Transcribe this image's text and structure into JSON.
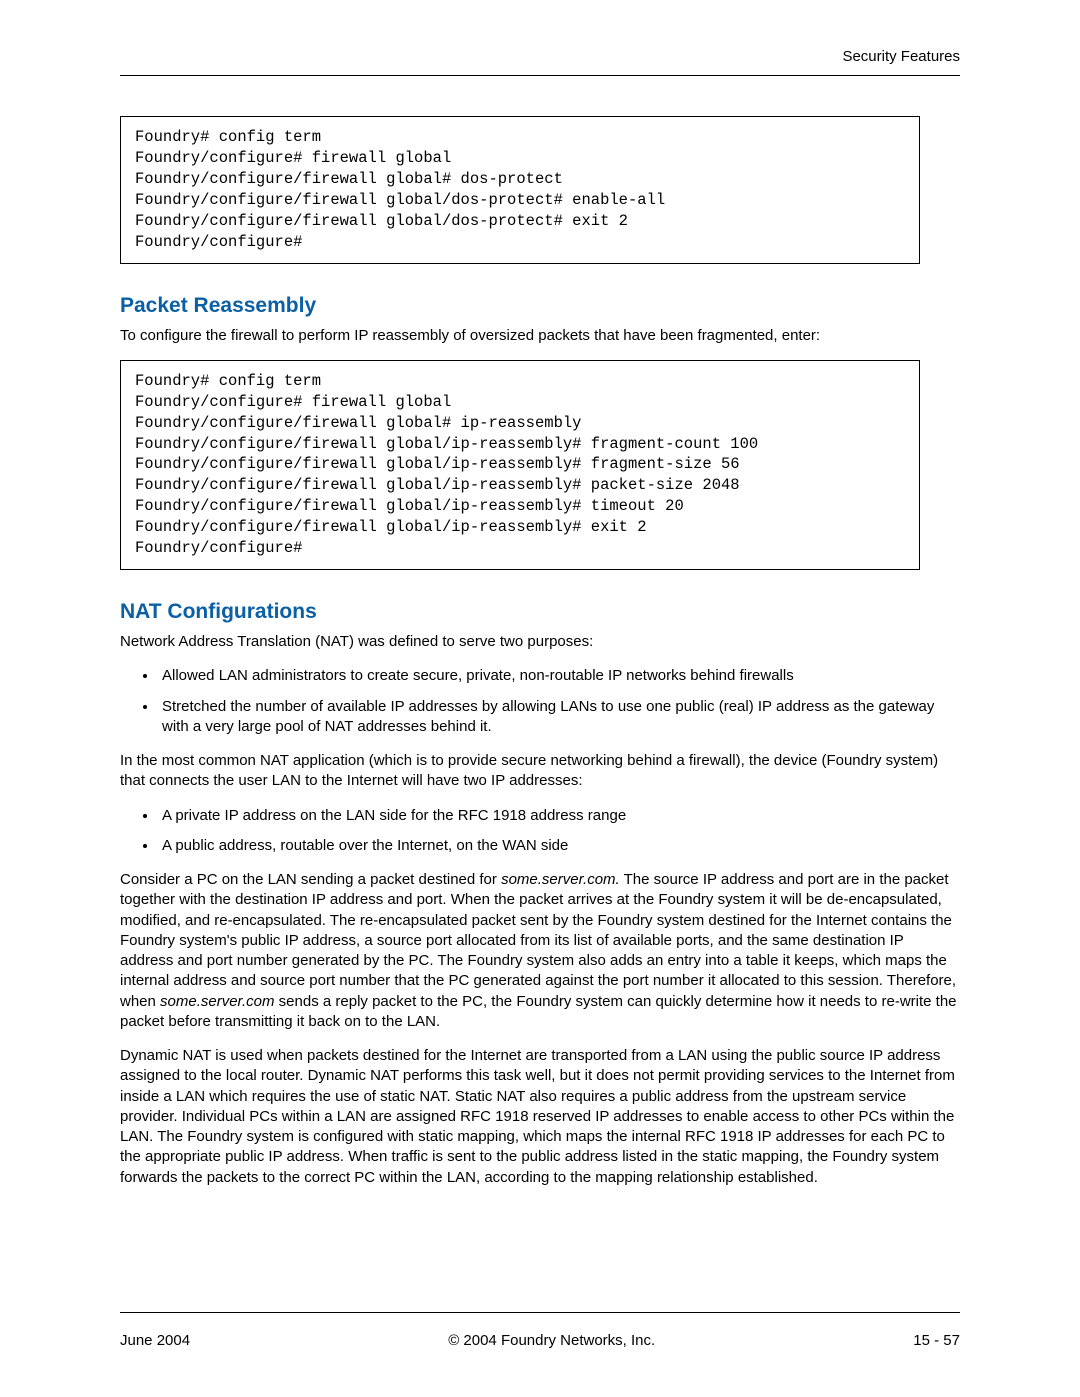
{
  "header": {
    "right_text": "Security Features"
  },
  "code_block_1": "Foundry# config term\nFoundry/configure# firewall global\nFoundry/configure/firewall global# dos-protect\nFoundry/configure/firewall global/dos-protect# enable-all\nFoundry/configure/firewall global/dos-protect# exit 2\nFoundry/configure#",
  "section_1": {
    "title": "Packet Reassembly",
    "para": "To configure the firewall to perform IP reassembly of oversized packets that have been fragmented, enter:"
  },
  "code_block_2": "Foundry# config term\nFoundry/configure# firewall global\nFoundry/configure/firewall global# ip-reassembly\nFoundry/configure/firewall global/ip-reassembly# fragment-count 100\nFoundry/configure/firewall global/ip-reassembly# fragment-size 56\nFoundry/configure/firewall global/ip-reassembly# packet-size 2048\nFoundry/configure/firewall global/ip-reassembly# timeout 20\nFoundry/configure/firewall global/ip-reassembly# exit 2\nFoundry/configure#",
  "section_2": {
    "title": "NAT Configurations",
    "intro": "Network Address Translation (NAT) was defined to serve two purposes:",
    "bullets_a": [
      "Allowed LAN administrators to create secure, private, non-routable IP networks behind firewalls",
      "Stretched the number of available IP addresses by allowing LANs to use one public (real) IP address as the gateway with a very large pool of NAT addresses behind it."
    ],
    "para_b": "In the most common NAT application (which is to provide secure networking behind a firewall), the device (Foundry system) that connects the user LAN to the Internet will have two IP addresses:",
    "bullets_b": [
      "A private IP address on the LAN side for the RFC 1918 address range",
      "A public address, routable over the Internet, on the WAN side"
    ],
    "para_c_pre": "Consider a PC on the LAN sending a packet destined for ",
    "para_c_ital1": "some.server.com.",
    "para_c_mid": " The source IP address and port are in the packet together with the destination IP address and port. When the packet arrives at the Foundry system it will be de-encapsulated, modified, and re-encapsulated. The re-encapsulated packet sent by the Foundry system destined for the Internet contains the Foundry system's public IP address, a source port allocated from its list of available ports, and the same destination IP address and port number generated by the PC. The Foundry system also adds an entry into a table it keeps, which maps the internal address and source port number that the PC generated against the port number it allocated to this session. Therefore, when ",
    "para_c_ital2": "some.server.com",
    "para_c_post": " sends a reply packet to the PC, the Foundry system can quickly determine how it needs to re-write the packet before transmitting it back on to the LAN.",
    "para_d": "Dynamic NAT is used when packets destined for the Internet are transported from a LAN using the public source IP address assigned to the local router. Dynamic NAT performs this task well, but it does not permit providing services to the Internet from inside a LAN which requires the use of static NAT. Static NAT also requires a public address from the upstream service provider. Individual PCs within a LAN are assigned RFC 1918 reserved IP addresses to enable access to other PCs within the LAN. The Foundry system is configured with static mapping, which maps the internal RFC 1918 IP addresses for each PC to the appropriate public IP address. When traffic is sent to the public address listed in the static mapping, the Foundry system forwards the packets to the correct PC within the LAN, according to the mapping relationship established."
  },
  "footer": {
    "left": "June 2004",
    "center": "© 2004 Foundry Networks, Inc.",
    "right": "15 - 57"
  }
}
